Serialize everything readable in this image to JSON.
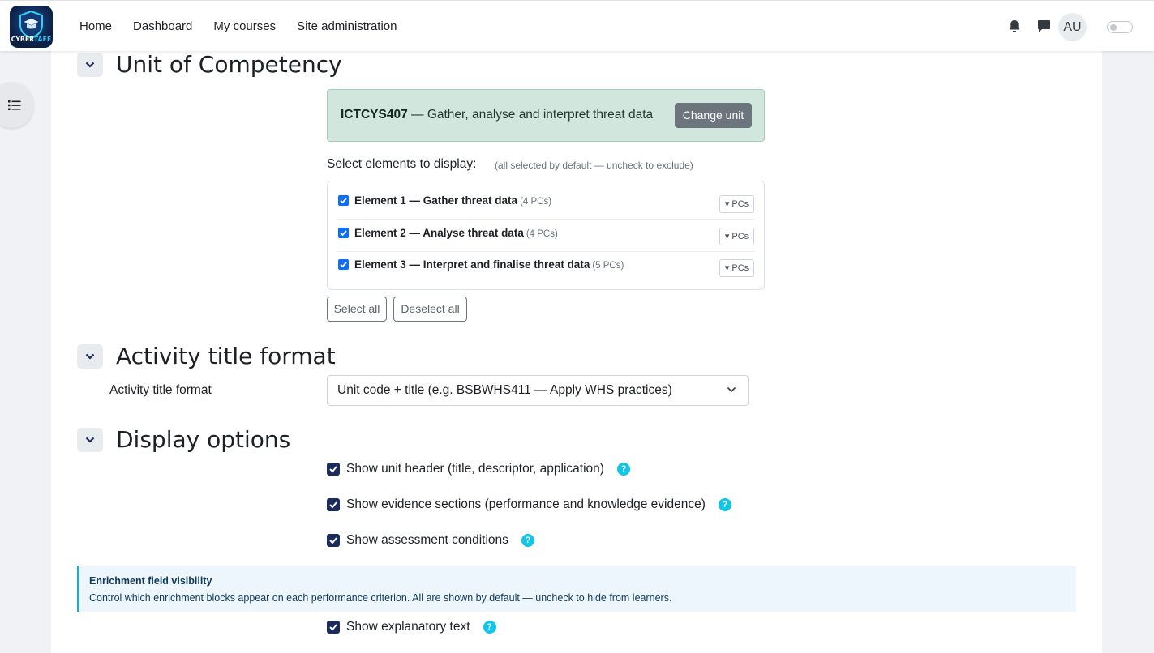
{
  "nav": {
    "logo_word": "CYBER",
    "logo_accent": "TAFE",
    "links": [
      "Home",
      "Dashboard",
      "My courses",
      "Site administration"
    ],
    "avatar_initials": "AU",
    "icons": [
      "bell-icon",
      "chat-icon"
    ]
  },
  "unit_section": {
    "title": "Unit of Competency",
    "unit_code": "ICTCYS407",
    "unit_title": " — Gather, analyse and interpret threat data",
    "change_unit_label": "Change unit",
    "select_label": "Select elements to display:",
    "select_hint": "(all selected by default — uncheck to exclude)",
    "elements": [
      {
        "label": "Element 1 — Gather threat data",
        "count": "(4 PCs)",
        "checked": true,
        "pcs_label": "▾ PCs"
      },
      {
        "label": "Element 2 — Analyse threat data",
        "count": "(4 PCs)",
        "checked": true,
        "pcs_label": "▾ PCs"
      },
      {
        "label": "Element 3 — Interpret and finalise threat data",
        "count": "(5 PCs)",
        "checked": true,
        "pcs_label": "▾ PCs"
      }
    ],
    "select_all_label": "Select all",
    "deselect_all_label": "Deselect all"
  },
  "title_format_section": {
    "title": "Activity title format",
    "field_label": "Activity title format",
    "selected_value": "Unit code + title (e.g. BSBWHS411 — Apply WHS practices)"
  },
  "display_section": {
    "title": "Display options",
    "options": [
      {
        "label": "Show unit header (title, descriptor, application)",
        "checked": true
      },
      {
        "label": "Show evidence sections (performance and knowledge evidence)",
        "checked": true
      },
      {
        "label": "Show assessment conditions",
        "checked": true
      }
    ],
    "info_title": "Enrichment field visibility",
    "info_desc": "Control which enrichment blocks appear on each performance criterion. All are shown by default — uncheck to hide from learners.",
    "enrichment_options": [
      {
        "label": "Show explanatory text",
        "checked": true
      }
    ]
  },
  "colors": {
    "brand_navy": "#1a2b5c",
    "unit_box_bg": "#d1e7dd",
    "help_cyan": "#11c5e8",
    "checkbox_blue": "#0d6efd"
  }
}
